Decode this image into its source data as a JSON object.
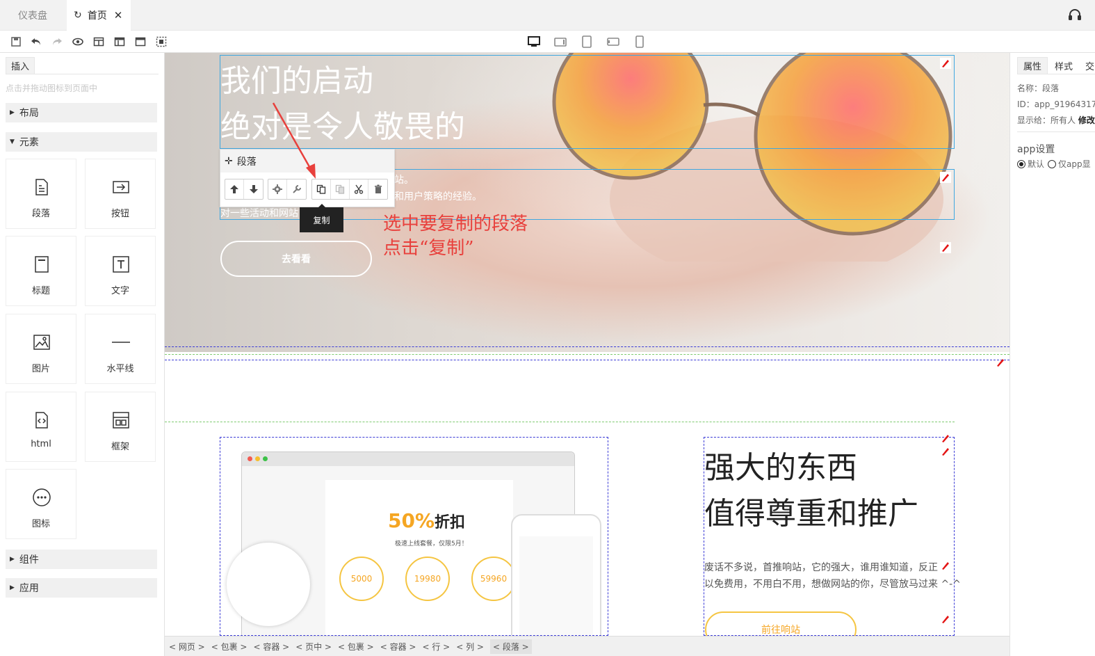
{
  "tabs": {
    "dashboard": "仪表盘",
    "home": "首页"
  },
  "left": {
    "insert_tab": "插入",
    "hint": "点击并拖动图标到页面中",
    "sections": {
      "layout": "布局",
      "elements": "元素",
      "components": "组件",
      "apps": "应用"
    },
    "elements": [
      "段落",
      "按钮",
      "标题",
      "文字",
      "图片",
      "水平线",
      "html",
      "框架",
      "图标"
    ]
  },
  "hero": {
    "title_1": "我们的启动",
    "title_2": "绝对是令人敬畏的",
    "p1": "站。",
    "p2": "和用户策略的经验。",
    "p3": "对一些活动和网站",
    "button": "去看看"
  },
  "ptool": {
    "label": "段落",
    "tooltip": "复制"
  },
  "annotation": {
    "line1": "选中要复制的段落",
    "line2": "点击“复制”"
  },
  "mockup": {
    "discount": "50%",
    "discount_word": "折扣",
    "sub": "极速上线套餐，仅限5月！",
    "prices": [
      "5000",
      "19980",
      "59960"
    ]
  },
  "feature": {
    "title_1": "强大的东西",
    "title_2": "值得尊重和推广",
    "p1": "废话不多说，首推响站，它的强大，谁用谁知道，反正",
    "p2": "以免费用，不用白不用，想做网站的你，尽管放马过来 ^-^",
    "button": "前往响站"
  },
  "right": {
    "tabs": [
      "属性",
      "样式",
      "交"
    ],
    "name": "名称：段落",
    "id": "ID：app_91964317",
    "visible_to": "显示给：所有人",
    "edit": "修改",
    "app_settings": "app设置",
    "radio_default": "默认",
    "radio_app": "仅app显"
  },
  "breadcrumb": [
    "< 网页 >",
    "< 包裹 >",
    "< 容器 >",
    "< 页中 >",
    "< 包裹 >",
    "< 容器 >",
    "< 行 >",
    "< 列 >",
    "< 段落 >"
  ],
  "colors": {
    "accent_red": "#e8403c",
    "select_blue": "#3fa7e0",
    "orange": "#f5a623"
  }
}
